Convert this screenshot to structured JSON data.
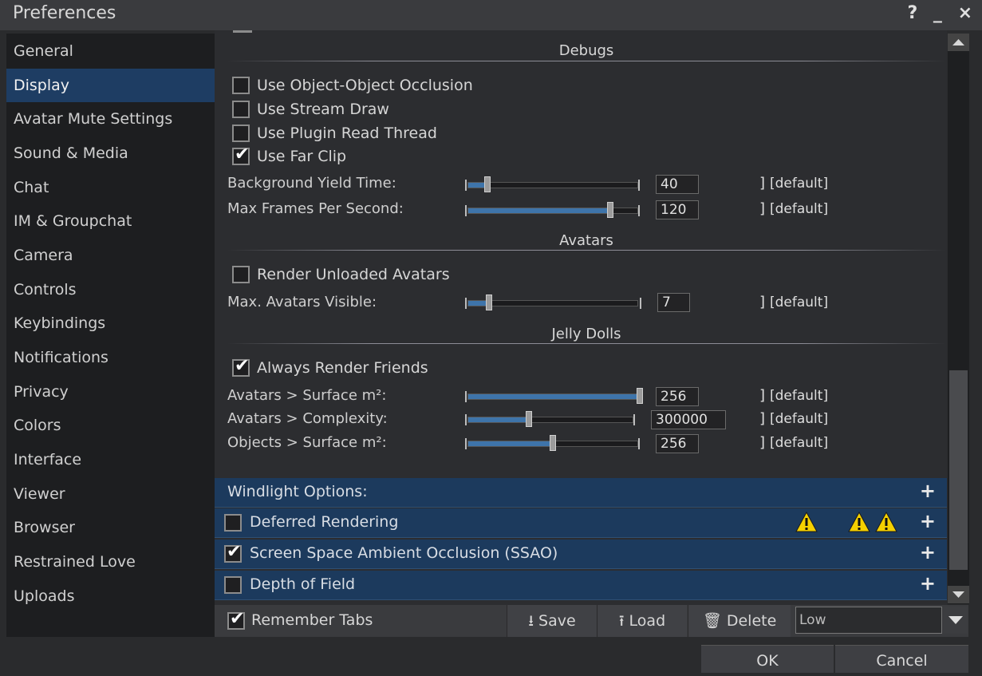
{
  "window": {
    "title": "Preferences",
    "help": "?",
    "minimize": "_",
    "close": "×"
  },
  "sidebar": {
    "items": [
      {
        "label": "General"
      },
      {
        "label": "Display"
      },
      {
        "label": "Avatar Mute Settings"
      },
      {
        "label": "Sound & Media"
      },
      {
        "label": "Chat"
      },
      {
        "label": "IM & Groupchat"
      },
      {
        "label": "Camera"
      },
      {
        "label": "Controls"
      },
      {
        "label": "Keybindings"
      },
      {
        "label": "Notifications"
      },
      {
        "label": "Privacy"
      },
      {
        "label": "Colors"
      },
      {
        "label": "Interface"
      },
      {
        "label": "Viewer"
      },
      {
        "label": "Browser"
      },
      {
        "label": "Restrained Love"
      },
      {
        "label": "Uploads"
      }
    ],
    "active": "Display"
  },
  "sections": {
    "debugs": "Debugs",
    "avatars": "Avatars",
    "jelly": "Jelly Dolls"
  },
  "debugs": {
    "occlusion": "Use Object-Object Occlusion",
    "stream_draw": "Use Stream Draw",
    "plugin_thread": "Use Plugin Read Thread",
    "far_clip": "Use Far Clip",
    "far_clip_checked": true
  },
  "sliders": {
    "bg_yield": {
      "label": "Background Yield Time:",
      "value": "40",
      "fraction": 0.12
    },
    "max_fps": {
      "label": "Max Frames Per Second:",
      "value": "120",
      "fraction": 0.83
    },
    "max_avatars": {
      "label": "Max. Avatars Visible:",
      "value": "7",
      "fraction": 0.12
    },
    "av_surface": {
      "label": "Avatars > Surface m²:",
      "value": "256",
      "fraction": 1.0
    },
    "av_complexity": {
      "label": "Avatars > Complexity:",
      "value": "300000",
      "fraction": 0.37
    },
    "obj_surface": {
      "label": "Objects > Surface m²:",
      "value": "256",
      "fraction": 0.5
    }
  },
  "default_link": "[default]",
  "avatars": {
    "render_unloaded": "Render Unloaded Avatars"
  },
  "jelly": {
    "always_friends": "Always Render Friends"
  },
  "bars": {
    "windlight": "Windlight Options:",
    "deferred": "Deferred Rendering",
    "ssao": "Screen Space Ambient Occlusion (SSAO)",
    "dof": "Depth of Field",
    "plus": "+"
  },
  "bottom": {
    "remember_tabs": "Remember Tabs",
    "save": "Save",
    "load": "Load",
    "delete": "Delete",
    "preset": "Low"
  },
  "buttons": {
    "ok": "OK",
    "cancel": "Cancel"
  }
}
